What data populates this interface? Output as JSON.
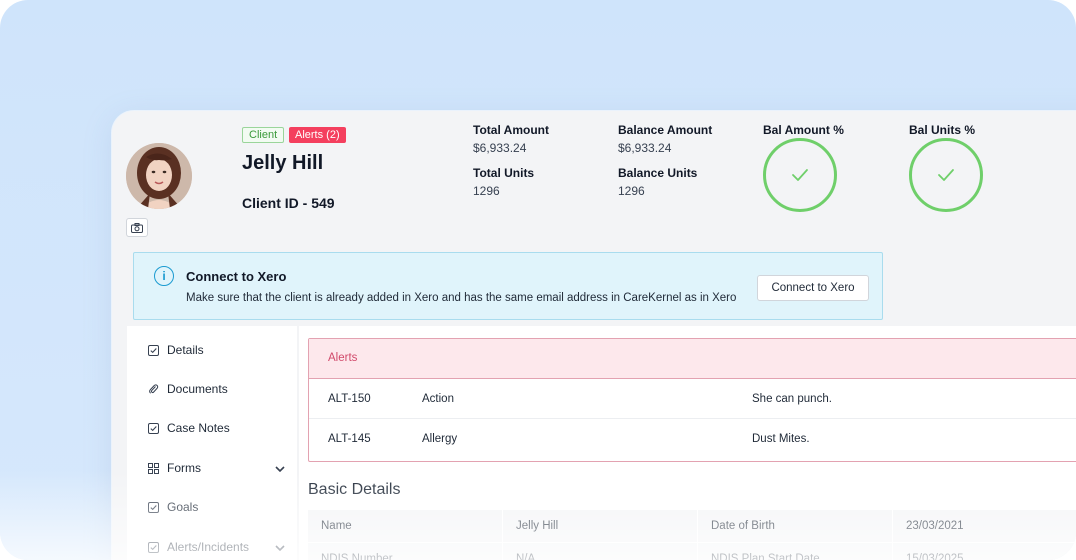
{
  "header": {
    "badges": {
      "client": "Client",
      "alerts": "Alerts (2)"
    },
    "client_name": "Jelly Hill",
    "client_id": "Client ID - 549",
    "stats": {
      "total_amount_label": "Total Amount",
      "total_amount_value": "$6,933.24",
      "balance_amount_label": "Balance Amount",
      "balance_amount_value": "$6,933.24",
      "total_units_label": "Total Units",
      "total_units_value": "1296",
      "balance_units_label": "Balance Units",
      "balance_units_value": "1296",
      "bal_amount_pct_label": "Bal Amount %",
      "bal_units_pct_label": "Bal Units %"
    },
    "colors": {
      "ring": "#6fcf6a",
      "alert_badge": "#f43f5e",
      "xero_accent": "#1b9bd1"
    }
  },
  "xero": {
    "title": "Connect to Xero",
    "description": "Make sure that the client is already added in Xero and has the same email address in CareKernel as in Xero",
    "button": "Connect to Xero"
  },
  "sidebar": {
    "items": [
      {
        "label": "Details",
        "icon": "checkbox-icon"
      },
      {
        "label": "Documents",
        "icon": "paperclip-icon"
      },
      {
        "label": "Case Notes",
        "icon": "checkbox-icon"
      },
      {
        "label": "Forms",
        "icon": "grid-icon",
        "expandable": true
      },
      {
        "label": "Goals",
        "icon": "checkbox-icon"
      },
      {
        "label": "Alerts/Incidents",
        "icon": "checkbox-icon",
        "expandable": true
      }
    ]
  },
  "alerts": {
    "title": "Alerts",
    "rows": [
      {
        "id": "ALT-150",
        "type": "Action",
        "description": "She can punch."
      },
      {
        "id": "ALT-145",
        "type": "Allergy",
        "description": "Dust Mites."
      }
    ]
  },
  "basic_details": {
    "title": "Basic Details",
    "rows": [
      [
        "Name",
        "Jelly Hill",
        "Date of Birth",
        "23/03/2021"
      ],
      [
        "NDIS Number",
        "N/A",
        "NDIS Plan Start Date",
        "15/03/2025"
      ]
    ]
  }
}
